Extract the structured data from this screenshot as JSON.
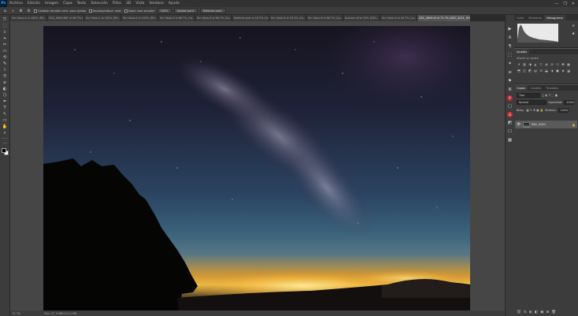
{
  "app": {
    "logo": "Ps"
  },
  "menu": [
    "Archivo",
    "Edición",
    "Imagen",
    "Capa",
    "Texto",
    "Selección",
    "Filtro",
    "3D",
    "Vista",
    "Ventana",
    "Ayuda"
  ],
  "window_controls": [
    "—",
    "❐",
    "✕"
  ],
  "options_bar": {
    "zoom_icons": [
      "⌂",
      "⌕",
      "⊕",
      "⊖"
    ],
    "checks": [
      "Cambiar tamaño vent. para ajustar",
      "Ampliar/reducir vent."
    ],
    "buttons": [
      "Zoom cont.arrastre",
      "100%",
      "Ajustar pant.",
      "Rellenar pant."
    ]
  },
  "tabs": [
    {
      "label": "Sin título-4 al 100% (RG...",
      "active": false
    },
    {
      "label": "DSC_0694.NEF al 66.7% (R...",
      "active": false
    },
    {
      "label": "Sin título-5 al 100% (RG...",
      "active": false
    },
    {
      "label": "Sin título-6 al 100% (RG...",
      "active": false
    },
    {
      "label": "Sin título-5 al 66.7% (Ca...",
      "active": false
    },
    {
      "label": "Sin título-6 al 66.7% (Ca...",
      "active": false
    },
    {
      "label": "Epifanio prof al 16.7% (Ca...",
      "active": false
    },
    {
      "label": "Sin título-6 al 33.3% (Ca...",
      "active": false
    },
    {
      "label": "Sin título-6 al 66.7% (Ca...",
      "active": false
    },
    {
      "label": "Autumn.tif al 33% (DSC...",
      "active": false
    },
    {
      "label": "Sin título-6 al 16.7% (Ca...",
      "active": false
    },
    {
      "label": "DSC_0694.tif al 72.7% (DSC_0021, RGB/16*)",
      "active": true
    }
  ],
  "tools": [
    "⤧",
    "⬚",
    "ↆ",
    "⌖",
    "✂",
    "▭",
    "⟲",
    "✎",
    "⌇",
    "⚲",
    "⌀",
    "◐",
    "⬡",
    "✒",
    "T",
    "↖",
    "▭",
    "✋",
    "⌕",
    "…"
  ],
  "status": {
    "zoom": "72.7%",
    "doc": "Doc: 57.4 MB/213.0 MB"
  },
  "right_strip": {
    "icons": [
      "▶",
      "A",
      "¶",
      "⬚",
      "✦",
      "≡",
      "⚑",
      "≣",
      "▢",
      "◩",
      "☐",
      "▦"
    ],
    "brand_icons": [
      "P",
      "G"
    ]
  },
  "histogram_panel": {
    "tabs": [
      {
        "label": "Color",
        "active": false
      },
      {
        "label": "Muestras",
        "active": false
      },
      {
        "label": "Histograma",
        "active": true
      }
    ],
    "buttons": [
      "⟳",
      "▲"
    ]
  },
  "adjust_panel": {
    "tabs": [
      {
        "label": "Ajustes",
        "active": true
      }
    ],
    "subtitle": "Añadir un ajuste",
    "icons": [
      "☀",
      "▥",
      "◑",
      "◭",
      "▽",
      "◍",
      "⚖",
      "☐",
      "◓",
      "▦",
      "⬒",
      "◫",
      "◩",
      "▤",
      "⊟",
      "⬓",
      "⬗",
      "▣",
      "◈",
      "◪"
    ]
  },
  "layers_panel": {
    "tabs": [
      {
        "label": "Capas",
        "active": true
      },
      {
        "label": "Canales",
        "active": false
      },
      {
        "label": "Trazados",
        "active": false
      }
    ],
    "kind": "Tipo",
    "blend_mode": "Normal",
    "opacity_label": "Opacidad:",
    "opacity_value": "100%",
    "lock_label": "Bloq.:",
    "fill_label": "Relleno:",
    "fill_value": "100%",
    "layer_name": "DSC_0021",
    "footer_icons": [
      "⛓",
      "fx",
      "◐",
      "◧",
      "▣",
      "⊞",
      "🗑"
    ]
  }
}
